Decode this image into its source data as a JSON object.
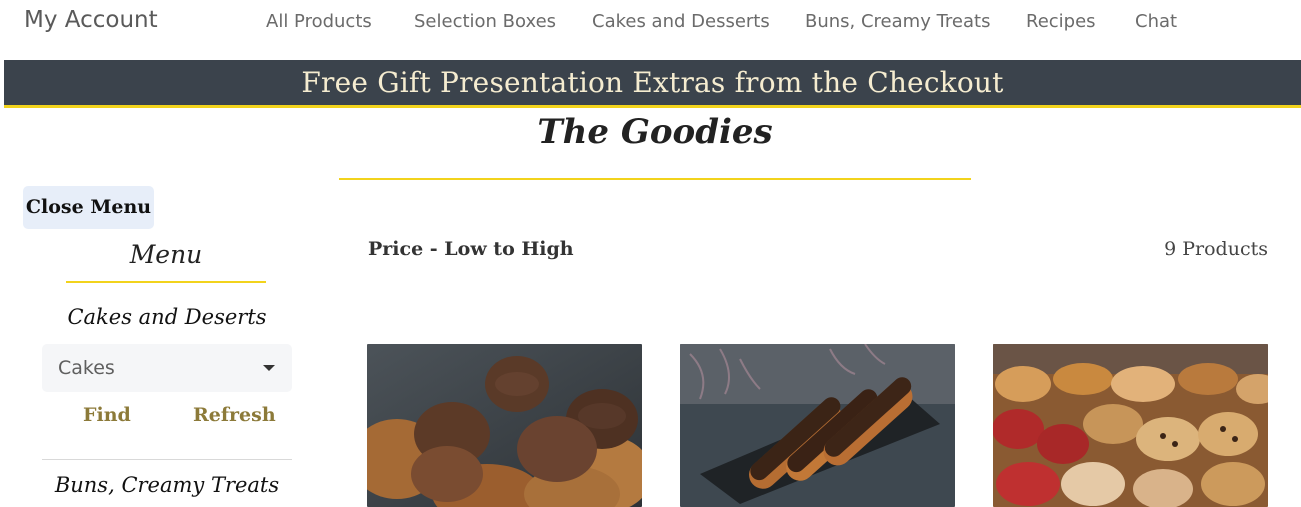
{
  "nav": {
    "brand": "My Account",
    "items": [
      {
        "label": "All Products"
      },
      {
        "label": "Selection Boxes"
      },
      {
        "label": "Cakes and Desserts"
      },
      {
        "label": "Buns, Creamy Treats"
      },
      {
        "label": "Recipes"
      },
      {
        "label": "Chat"
      }
    ]
  },
  "banner": {
    "text": "Free Gift Presentation Extras from the Checkout"
  },
  "page": {
    "title": "The Goodies"
  },
  "sidebar": {
    "close_label": "Close Menu",
    "menu_title": "Menu",
    "sections": [
      {
        "title": "Cakes and Deserts",
        "select_value": "Cakes",
        "find_label": "Find",
        "refresh_label": "Refresh"
      },
      {
        "title": "Buns, Creamy Treats"
      }
    ]
  },
  "toolbar": {
    "sort_label": "Price - Low to High",
    "count_label": "9 Products"
  },
  "products": [
    {
      "image": "cookies-photo"
    },
    {
      "image": "eclairs-photo"
    },
    {
      "image": "pastries-photo"
    }
  ],
  "colors": {
    "accent": "#f2d31c",
    "banner": "#3b434c",
    "link": "#8c7a39"
  }
}
